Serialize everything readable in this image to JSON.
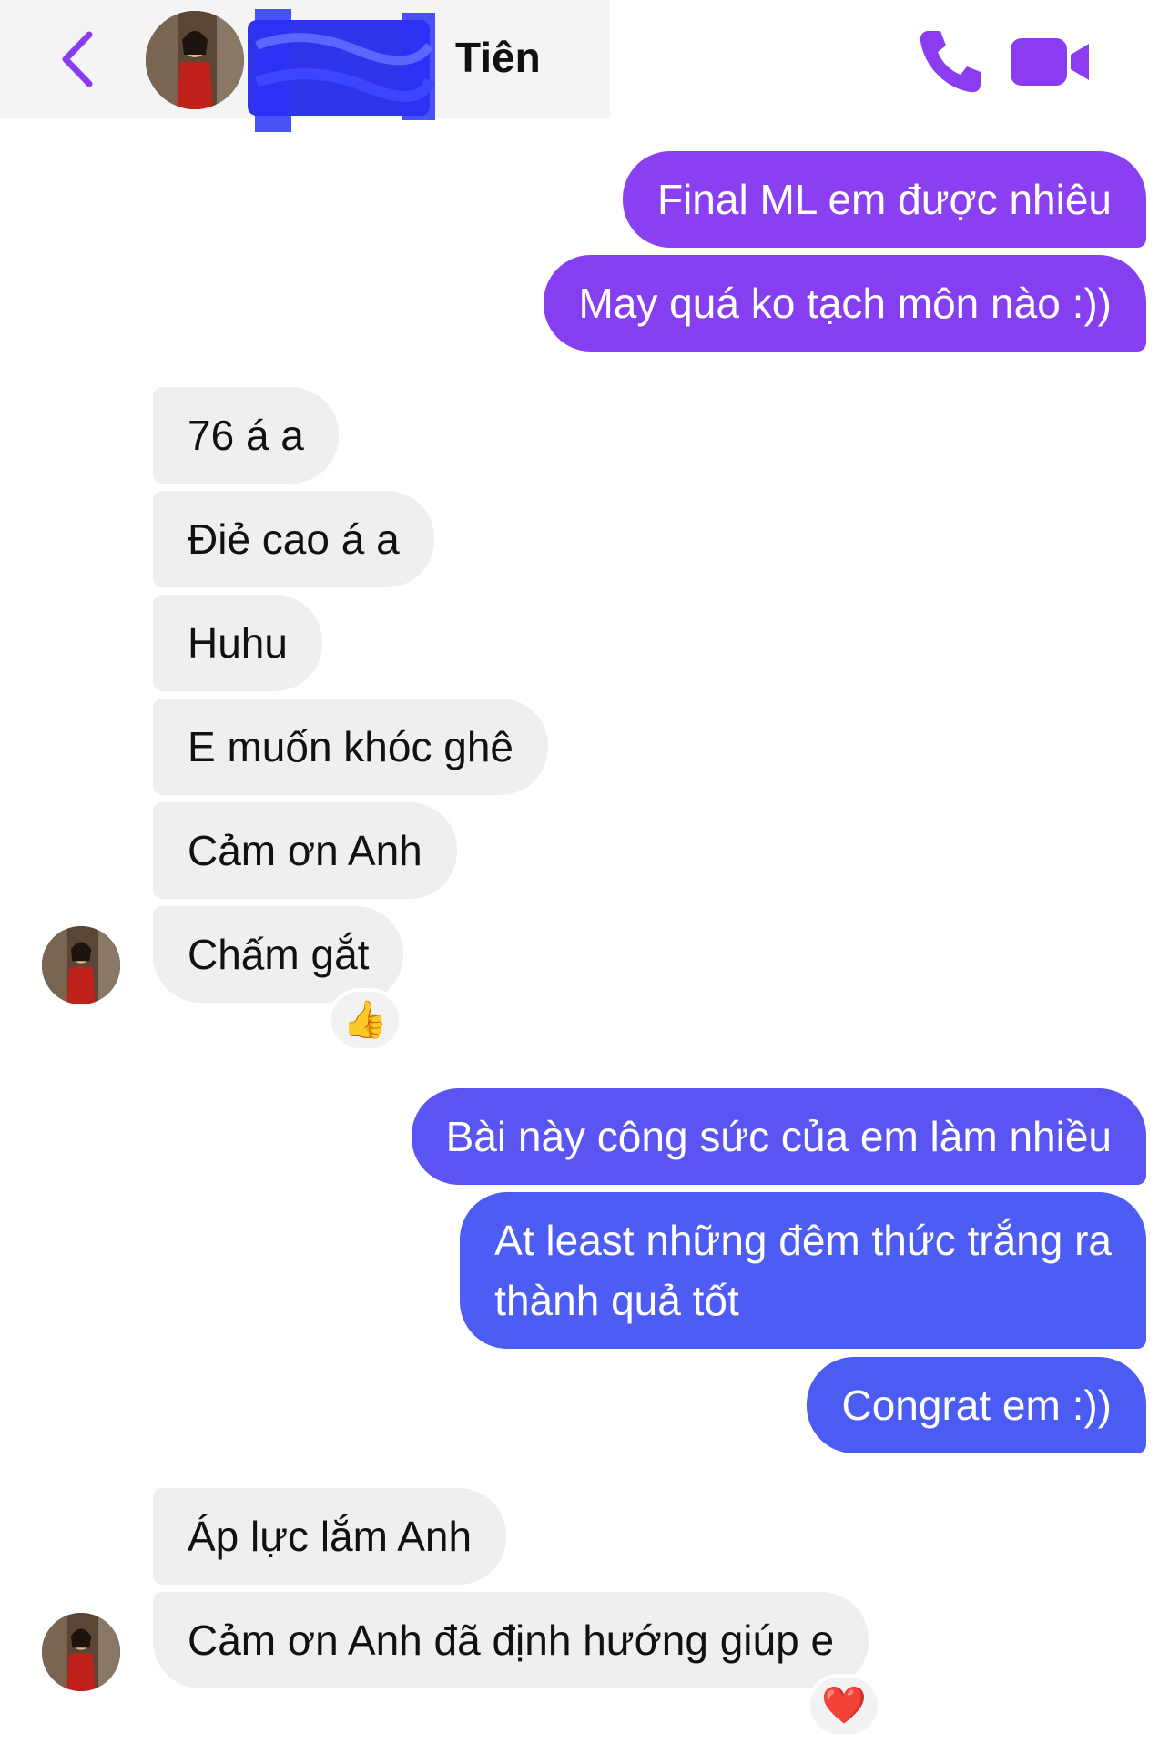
{
  "header": {
    "contact_name": "Tiên",
    "back_icon": "chevron-left-icon",
    "call_icon": "phone-icon",
    "video_icon": "video-camera-icon",
    "accent_color": "#8b3cf0"
  },
  "messages": [
    {
      "text": "Final ML em được nhiêu",
      "from": "me"
    },
    {
      "text": "May quá ko tạch môn nào :))",
      "from": "me"
    },
    {
      "text": "76 á a",
      "from": "them"
    },
    {
      "text": "Điẻ cao á a",
      "from": "them"
    },
    {
      "text": "Huhu",
      "from": "them"
    },
    {
      "text": "E muốn khóc ghê",
      "from": "them"
    },
    {
      "text": "Cảm ơn Anh",
      "from": "them"
    },
    {
      "text": "Chấm gắt",
      "from": "them",
      "reaction": "👍"
    },
    {
      "text": "Bài này công sức của em làm nhiều",
      "from": "me"
    },
    {
      "text_line1": "At least những đêm thức trắng ra",
      "text_line2": "thành quả tốt",
      "from": "me"
    },
    {
      "text": "Congrat em :))",
      "from": "me"
    },
    {
      "text": "Áp lực lắm Anh",
      "from": "them"
    },
    {
      "text": "Cảm ơn Anh đã định hướng giúp e",
      "from": "them",
      "reaction": "❤️"
    }
  ],
  "colors": {
    "outgoing_top": "#8a3ff0",
    "outgoing_bottom": "#4b5bf2",
    "incoming": "#efefef"
  }
}
